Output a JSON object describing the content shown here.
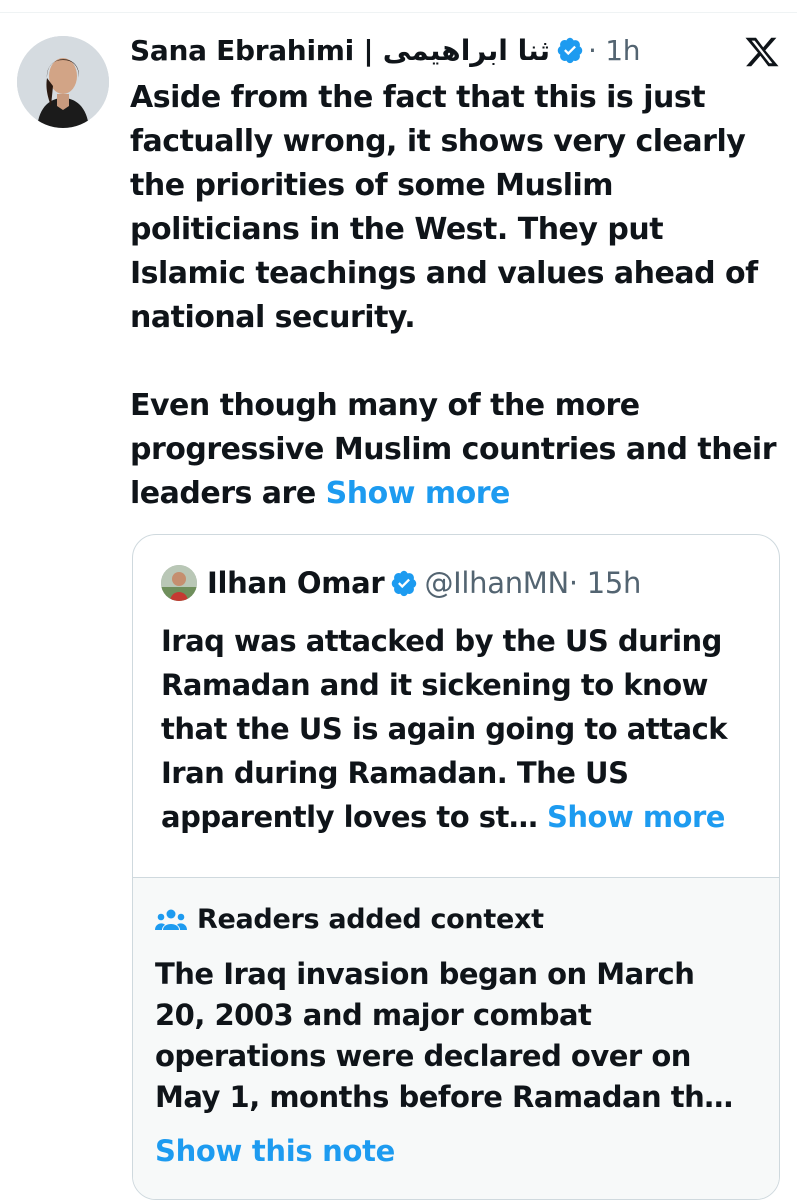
{
  "tweet": {
    "author": "Sana Ebrahimi | ثنا ابراهیمی",
    "time": "· 1h",
    "lines": [
      "Aside from the fact that this is just",
      "factually wrong, it shows very clearly",
      "the priorities of some Muslim",
      "politicians in the West. They put",
      "Islamic teachings and values ahead of",
      "national security.",
      "Even though many of the more",
      "progressive Muslim countries and their",
      "leaders are"
    ],
    "show_more": "Show more"
  },
  "quote": {
    "author": "Ilhan Omar",
    "handle": "@IlhanMN",
    "time": "· 15h",
    "lines": [
      "Iraq was attacked by the US during",
      "Ramadan and it sickening to know",
      "that the US is again going to attack",
      "Iran during Ramadan.  The US",
      "apparently loves to st…"
    ],
    "show_more": "Show more"
  },
  "note": {
    "title": "Readers added context",
    "lines": [
      "The Iraq invasion began on March",
      "20, 2003 and major combat",
      "operations were declared over on",
      "May 1, months before Ramadan th…"
    ],
    "link": "Show this note"
  },
  "icons": {
    "verified": "verified-badge-icon",
    "x_logo": "x-logo-icon",
    "readers": "people-icon"
  },
  "colors": {
    "accent": "#1d9bf0",
    "text": "#0f1419",
    "muted": "#536471",
    "border": "#cfd9de",
    "note_bg": "#f7f9f9"
  }
}
